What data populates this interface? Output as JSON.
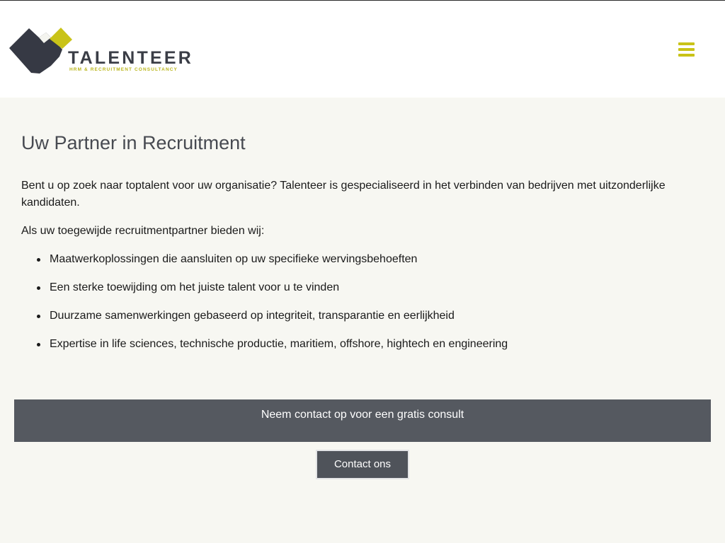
{
  "brand": {
    "name": "TALENTEER",
    "tagline": "HRM & RECRUITMENT CONSULTANCY",
    "colors": {
      "dark": "#3a3d46",
      "accent": "#c9c318"
    }
  },
  "header": {
    "menu_icon": "hamburger-menu-icon"
  },
  "main": {
    "title": "Uw Partner in Recruitment",
    "intro": "Bent u op zoek naar toptalent voor uw organisatie? Talenteer is gespecialiseerd in het verbinden van bedrijven met uitzonderlijke kandidaten.",
    "lead": "Als uw toegewijde recruitmentpartner bieden wij:",
    "features": [
      "Maatwerkoplossingen die aansluiten op uw specifieke wervingsbehoeften",
      "Een sterke toewijding om het juiste talent voor u te vinden",
      "Duurzame samenwerkingen gebaseerd op integriteit, transparantie en eerlijkheid",
      "Expertise in life sciences, technische productie, maritiem, offshore, hightech en engineering"
    ]
  },
  "cta": {
    "text": "Neem contact op voor een gratis consult",
    "button_label": "Contact ons",
    "band_color": "#555960"
  }
}
